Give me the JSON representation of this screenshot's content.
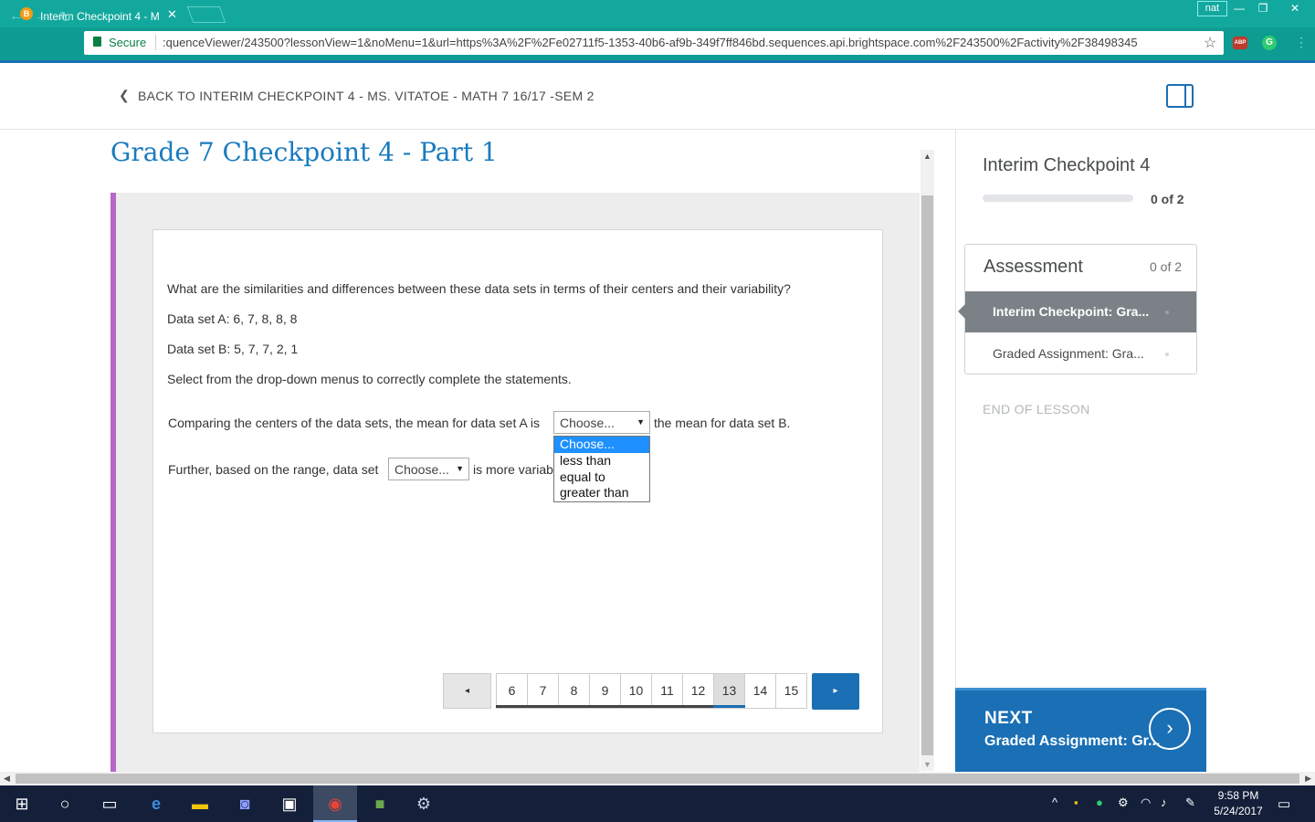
{
  "browser": {
    "tab_title": "Interim Checkpoint 4 - M",
    "tab_favicon": "B",
    "user_chip": "nat",
    "secure_label": "Secure",
    "url": ":quenceViewer/243500?lessonView=1&noMenu=1&url=https%3A%2F%2Fe02711f5-1353-40b6-af9b-349f7ff846bd.sequences.api.brightspace.com%2F243500%2Factivity%2F38498345",
    "ext_abp": "ABP",
    "ext_g": "G"
  },
  "header": {
    "back_text": "BACK TO INTERIM CHECKPOINT 4 - MS. VITATOE - MATH 7 16/17 -SEM 2"
  },
  "content": {
    "title": "Grade 7 Checkpoint 4 - Part 1",
    "question": "What are the similarities and differences between these data sets in terms of their centers and their variability?",
    "dataset_a": "Data set A: 6, 7, 8, 8, 8",
    "dataset_b": "Data set B: 5, 7, 7, 2, 1",
    "instructions": "Select from the drop-down menus to correctly complete the statements.",
    "statement1_pre": "Comparing the centers of the data sets, the mean for data set A is",
    "statement1_post": "the mean for data set B.",
    "select1_value": "Choose...",
    "statement2_pre": "Further, based on the range, data set",
    "select2_value": "Choose...",
    "statement2_post": "is more variab",
    "dropdown_options": [
      "Choose...",
      "less than",
      "equal to",
      "greater than"
    ]
  },
  "pagination": {
    "prev": "◂",
    "next": "▸",
    "pages": [
      "6",
      "7",
      "8",
      "9",
      "10",
      "11",
      "12",
      "13",
      "14",
      "15"
    ],
    "current": "13"
  },
  "sidebar": {
    "title": "Interim Checkpoint 4",
    "progress_fraction": 0,
    "progress_count": "0 of 2",
    "assessment_title": "Assessment",
    "assessment_count": "0 of 2",
    "items": [
      {
        "label": "Interim Checkpoint: Gra...",
        "active": true
      },
      {
        "label": "Graded Assignment: Gra...",
        "active": false
      }
    ],
    "end_of_lesson": "END OF LESSON",
    "next_label": "NEXT",
    "next_sub": "Graded Assignment: Gr..."
  },
  "taskbar": {
    "time": "9:58 PM",
    "date": "5/24/2017"
  },
  "colors": {
    "browser_teal": "#13a89e",
    "brand_blue": "#1a6fb5",
    "title_blue": "#1a7bbf",
    "purple_accent": "#b667c8",
    "dropdown_highlight": "#1e90ff"
  }
}
